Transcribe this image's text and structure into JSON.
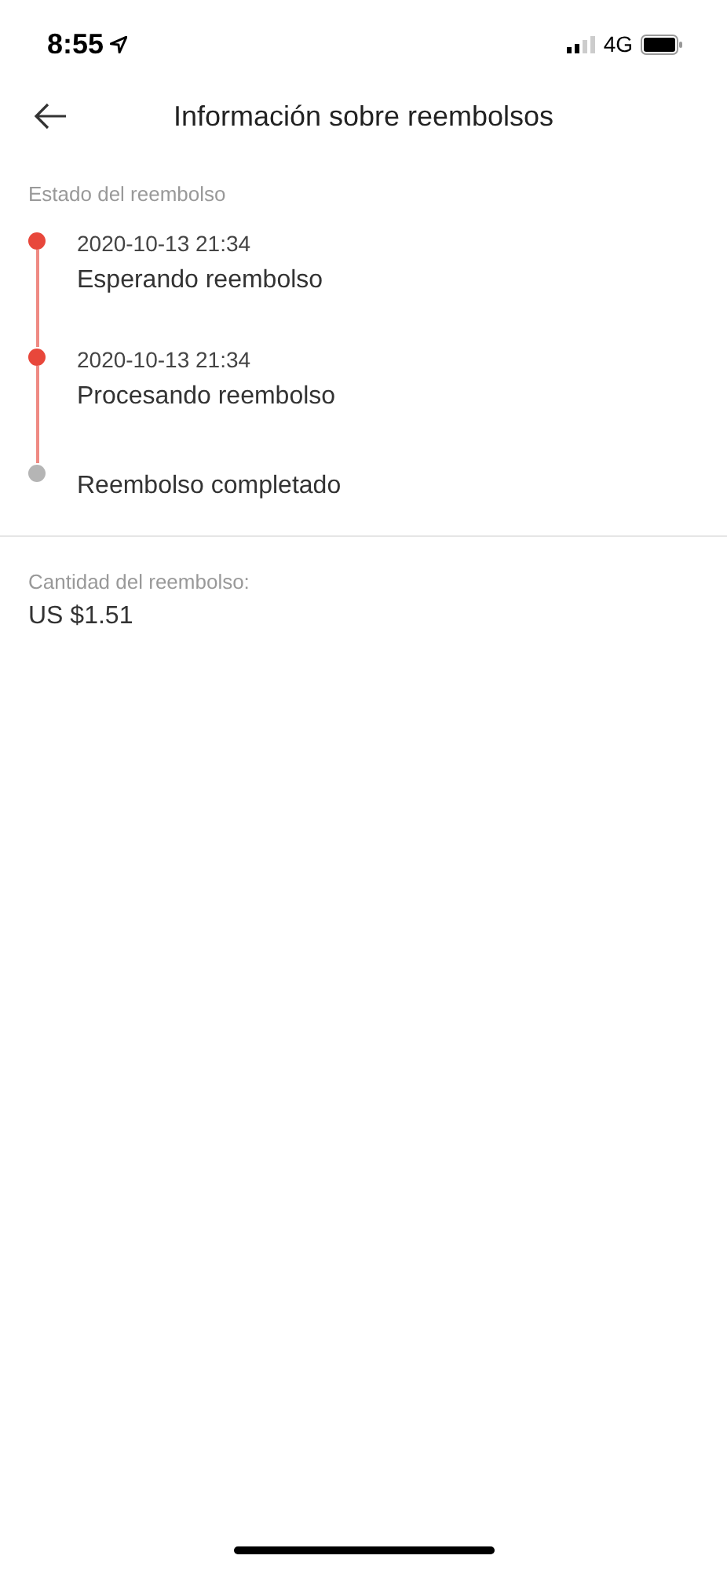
{
  "status_bar": {
    "time": "8:55",
    "network": "4G"
  },
  "header": {
    "title": "Información sobre reembolsos"
  },
  "refund_status": {
    "label": "Estado del reembolso",
    "steps": [
      {
        "date": "2020-10-13 21:34",
        "title": "Esperando reembolso",
        "done": true
      },
      {
        "date": "2020-10-13 21:34",
        "title": "Procesando reembolso",
        "done": true
      },
      {
        "title": "Reembolso completado",
        "done": false
      }
    ]
  },
  "refund_amount": {
    "label": "Cantidad del reembolso:",
    "value": "US $1.51"
  }
}
